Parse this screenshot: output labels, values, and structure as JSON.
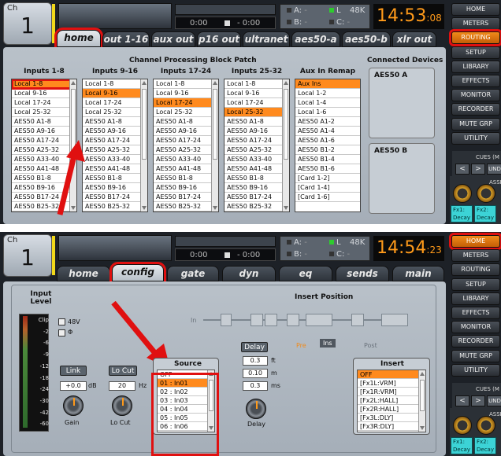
{
  "panel1": {
    "ch_label": "Ch",
    "ch_number": "1",
    "timecode_left": "0:00",
    "timecode_right": "- 0:00",
    "sync": {
      "a": "A:",
      "a_val": "-",
      "b": "B:",
      "b_val": "-",
      "l": "L",
      "rate": "48K",
      "c": "C:",
      "c_val": "-"
    },
    "clock": "14:53",
    "clock_sec": ":08",
    "tabs": [
      "home",
      "out 1-16",
      "aux out",
      "p16 out",
      "ultranet",
      "aes50-a",
      "aes50-b",
      "xlr out"
    ],
    "title": "Channel Processing Block Patch",
    "connected_title": "Connected Devices",
    "columns": [
      {
        "header": "Inputs 1-8",
        "selected": 0,
        "items": [
          "Local 1-8",
          "Local 9-16",
          "Local 17-24",
          "Local 25-32",
          "AES50 A1-8",
          "AES50 A9-16",
          "AES50 A17-24",
          "AES50 A25-32",
          "AES50 A33-40",
          "AES50 A41-48",
          "AES50 B1-8",
          "AES50 B9-16",
          "AES50 B17-24",
          "AES50 B25-32"
        ]
      },
      {
        "header": "Inputs 9-16",
        "selected": 1,
        "items": [
          "Local 1-8",
          "Local 9-16",
          "Local 17-24",
          "Local 25-32",
          "AES50 A1-8",
          "AES50 A9-16",
          "AES50 A17-24",
          "AES50 A25-32",
          "AES50 A33-40",
          "AES50 A41-48",
          "AES50 B1-8",
          "AES50 B9-16",
          "AES50 B17-24",
          "AES50 B25-32"
        ]
      },
      {
        "header": "Inputs 17-24",
        "selected": 2,
        "items": [
          "Local 1-8",
          "Local 9-16",
          "Local 17-24",
          "Local 25-32",
          "AES50 A1-8",
          "AES50 A9-16",
          "AES50 A17-24",
          "AES50 A25-32",
          "AES50 A33-40",
          "AES50 A41-48",
          "AES50 B1-8",
          "AES50 B9-16",
          "AES50 B17-24",
          "AES50 B25-32"
        ]
      },
      {
        "header": "Inputs 25-32",
        "selected": 3,
        "items": [
          "Local 1-8",
          "Local 9-16",
          "Local 17-24",
          "Local 25-32",
          "AES50 A1-8",
          "AES50 A9-16",
          "AES50 A17-24",
          "AES50 A25-32",
          "AES50 A33-40",
          "AES50 A41-48",
          "AES50 B1-8",
          "AES50 B9-16",
          "AES50 B17-24",
          "AES50 B25-32"
        ]
      },
      {
        "header": "Aux In Remap",
        "selected": 0,
        "items": [
          "Aux Ins",
          "Local 1-2",
          "Local 1-4",
          "Local 1-6",
          "AES50 A1-2",
          "AES50 A1-4",
          "AES50 A1-6",
          "AES50 B1-2",
          "AES50 B1-4",
          "AES50 B1-6",
          "[Card 1-2]",
          "[Card 1-4]",
          "[Card 1-6]"
        ]
      }
    ],
    "devices": [
      "AES50 A",
      "AES50 B"
    ],
    "sidebar": [
      "HOME",
      "METERS",
      "ROUTING",
      "SETUP",
      "LIBRARY",
      "EFFECTS",
      "MONITOR",
      "RECORDER",
      "MUTE GRP",
      "UTILITY"
    ],
    "sidebar_active": "ROUTING",
    "cues_label": "CUES (M",
    "cues_buttons": [
      "<",
      ">",
      "UND"
    ],
    "assign_label": "ASSI",
    "fx": [
      "Fx1: Decay",
      "Fx2: Decay"
    ]
  },
  "panel2": {
    "ch_label": "Ch",
    "ch_number": "1",
    "timecode_left": "0:00",
    "timecode_right": "- 0:00",
    "sync": {
      "a": "A:",
      "a_val": "-",
      "b": "B:",
      "b_val": "-",
      "l": "L",
      "rate": "48K",
      "c": "C:",
      "c_val": "-"
    },
    "clock": "14:54",
    "clock_sec": ":23",
    "tabs": [
      "home",
      "config",
      "gate",
      "dyn",
      "eq",
      "sends",
      "main"
    ],
    "input_level": "Input Level",
    "meter_marks": [
      "Clip",
      "-2",
      "-6",
      "-9",
      "-12",
      "-18",
      "-24",
      "-30",
      "-42",
      "-60"
    ],
    "phantom": "48V",
    "phase": "Φ",
    "link": "Link",
    "gain_value": "+0.0",
    "gain_unit": "dB",
    "gain_label": "Gain",
    "locut_label": "Lo Cut",
    "locut_value": "20",
    "locut_unit": "Hz",
    "locut_knob_label": "Lo Cut",
    "source_title": "Source",
    "source_items": [
      "OFF",
      "01 : In01",
      "02 : In02",
      "03 : In03",
      "04 : In04",
      "05 : In05",
      "06 : In06"
    ],
    "source_selected": 1,
    "delay_label": "Delay",
    "delay_ft": "0.3",
    "delay_ft_unit": "ft",
    "delay_m": "0.10",
    "delay_m_unit": "m",
    "delay_ms": "0.3",
    "delay_ms_unit": "ms",
    "delay_knob_label": "Delay",
    "insert_position": "Insert Position",
    "in_label": "In",
    "pre": "Pre",
    "ins": "Ins",
    "post": "Post",
    "insert_title": "Insert",
    "insert_items": [
      "OFF",
      "[Fx1L:VRM]",
      "[Fx1R:VRM]",
      "[Fx2L:HALL]",
      "[Fx2R:HALL]",
      "[Fx3L:DLY]",
      "[Fx3R:DLY]"
    ],
    "insert_selected": 0,
    "sidebar": [
      "HOME",
      "METERS",
      "ROUTING",
      "SETUP",
      "LIBRARY",
      "EFFECTS",
      "MONITOR",
      "RECORDER",
      "MUTE GRP",
      "UTILITY"
    ],
    "sidebar_active": "HOME",
    "cues_label": "CUES (M",
    "cues_buttons": [
      "<",
      ">",
      "UND"
    ],
    "assign_label": "ASSI",
    "fx": [
      "Fx1: Decay",
      "Fx2: Decay"
    ]
  }
}
